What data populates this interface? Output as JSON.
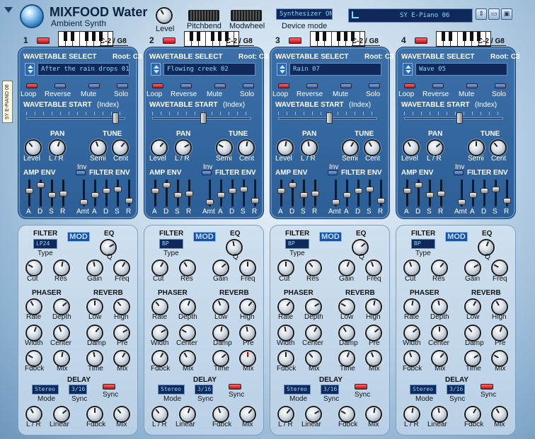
{
  "header": {
    "title": "MIXFOOD Water",
    "subtitle": "Ambient Synth",
    "level_label": "Level",
    "pitchbend_label": "Pitchbend",
    "modwheel_label": "Modwheel",
    "device_mode_value": "Synthesizer ON",
    "device_mode_label": "Device mode",
    "preset_name": "SY E-Piano 06",
    "side_tab": "SY E-PIANO 06"
  },
  "colors": {
    "panel": "#2d5e96",
    "lcd": "#0f2a5a",
    "led_on": "#c01010",
    "led_off": "#3a62a8"
  },
  "labels": {
    "wavetable_select": "WAVETABLE SELECT",
    "loop": "Loop",
    "reverse": "Reverse",
    "mute": "Mute",
    "solo": "Solo",
    "wavetable_start": "WAVETABLE START",
    "index": "(Index)",
    "pan": "PAN",
    "tune": "TUNE",
    "level": "Level",
    "lr": "L / R",
    "semi": "Semi",
    "cent": "Cent",
    "amp_env": "AMP ENV",
    "filter_env": "FILTER ENV",
    "inv": "Inv",
    "a": "A",
    "d": "D",
    "s": "S",
    "r": "R",
    "amt": "Amt",
    "filter": "FILTER",
    "mod": "MOD",
    "eq": "EQ",
    "type": "Type",
    "q": "Q",
    "cut": "Cut",
    "res": "Res",
    "gain": "Gain",
    "freq": "Freq",
    "phaser": "PHASER",
    "reverb": "REVERB",
    "rate": "Rate",
    "depth": "Depth",
    "low": "Low",
    "high": "High",
    "width": "Width",
    "center": "Center",
    "damp": "Damp",
    "pre": "Pre",
    "fdbck": "Fdbck",
    "mix": "Mix",
    "time": "Time",
    "delay": "DELAY",
    "mode": "Mode",
    "sync": "Sync",
    "linear": "Linear"
  },
  "layers": [
    {
      "number": "1",
      "range": "C-2 / G8",
      "root": "Root: C3",
      "wave": "After the rain drops 01",
      "filter_type": "LP24",
      "delay_mode": "Stereo",
      "delay_sync": "3/16",
      "loop_on": true,
      "wt_start": 0.9
    },
    {
      "number": "2",
      "range": "C-2 / G8",
      "root": "Root: C3",
      "wave": "Flowing creek 02",
      "filter_type": "BP",
      "delay_mode": "Stereo",
      "delay_sync": "3/16",
      "loop_on": true,
      "wt_start": 0.5
    },
    {
      "number": "3",
      "range": "C-2 / G8",
      "root": "Root: C3",
      "wave": "Rain 07",
      "filter_type": "BP",
      "delay_mode": "Stereo",
      "delay_sync": "3/16",
      "loop_on": true,
      "wt_start": 0.5
    },
    {
      "number": "4",
      "range": "C-2 / G8",
      "root": "Root: C3",
      "wave": "Wave 05",
      "filter_type": "BP",
      "delay_mode": "Stereo",
      "delay_sync": "3/16",
      "loop_on": true,
      "wt_start": 0.55
    }
  ]
}
